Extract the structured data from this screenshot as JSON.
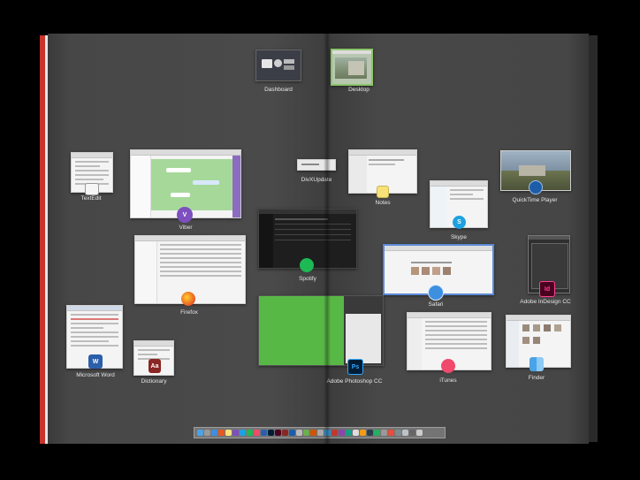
{
  "spaces": [
    {
      "label": "Dashboard"
    },
    {
      "label": "Desktop"
    }
  ],
  "windows": [
    {
      "label": "TextEdit"
    },
    {
      "label": "Viber"
    },
    {
      "label": "DivXUpdate"
    },
    {
      "label": "Notes"
    },
    {
      "label": "Skype"
    },
    {
      "label": "QuickTime Player"
    },
    {
      "label": "Spotify"
    },
    {
      "label": "Firefox"
    },
    {
      "label": "Safari"
    },
    {
      "label": "Adobe InDesign CC"
    },
    {
      "label": "Microsoft Word"
    },
    {
      "label": "Dictionary"
    },
    {
      "label": "Adobe Photoshop CC"
    },
    {
      "label": "iTunes"
    },
    {
      "label": "Finder"
    }
  ],
  "icons": {
    "viber": "viber-icon",
    "firefox": "firefox-icon",
    "spotify": "spotify-icon",
    "skype": "skype-icon",
    "safari": "safari-icon",
    "quicktime": "quicktime-icon",
    "indesign": "indesign-icon",
    "indesign_glyph": "Id",
    "photoshop": "photoshop-icon",
    "photoshop_glyph": "Ps",
    "word": "word-icon",
    "word_glyph": "W",
    "dictionary": "dictionary-icon",
    "dictionary_glyph": "Aa",
    "itunes": "itunes-icon",
    "finder": "finder-icon",
    "textedit": "textedit-icon",
    "notes": "notes-icon"
  },
  "colors": {
    "viber_bg": "#a6d89a",
    "spotify_bg": "#1e1e1e",
    "photoshop_canvas": "#58b845",
    "spine_accent": "#c8352b"
  }
}
